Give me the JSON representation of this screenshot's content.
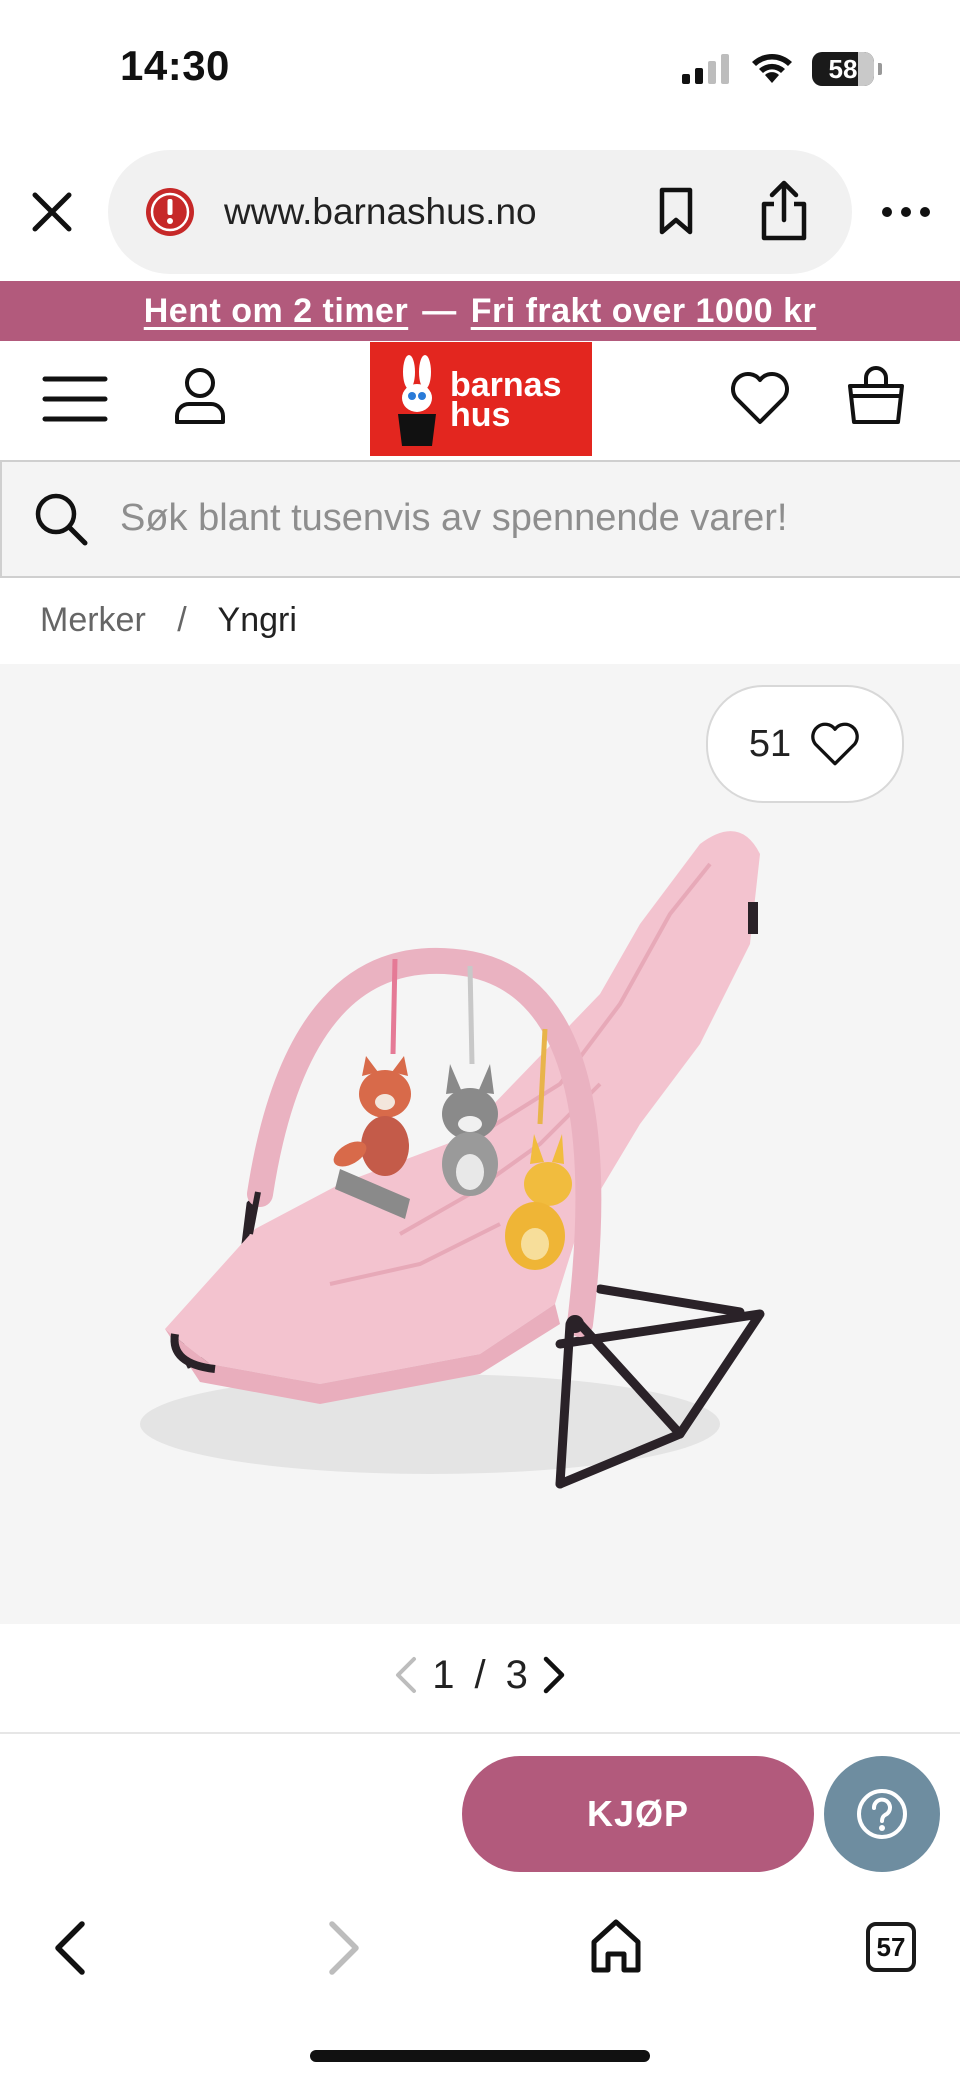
{
  "status_bar": {
    "time": "14:30",
    "battery": "58"
  },
  "browser": {
    "url": "www.barnashus.no",
    "icons": [
      "close-icon",
      "warning-icon",
      "bookmark-icon",
      "share-icon",
      "more-icon"
    ]
  },
  "promo": {
    "left_link": "Hent om 2 timer",
    "separator": "—",
    "right_link": "Fri frakt over 1000 kr"
  },
  "header": {
    "logo_line1": "barnas",
    "logo_line2": "hus",
    "icons": [
      "menu-icon",
      "user-icon",
      "heart-icon",
      "bag-icon"
    ]
  },
  "search": {
    "placeholder": "Søk blant tusenvis av spennende varer!"
  },
  "breadcrumb": {
    "items": [
      "Merker",
      "Yngri"
    ],
    "separator": "/"
  },
  "product": {
    "favorites_count": "51"
  },
  "pager": {
    "current": "1",
    "separator": "/",
    "total": "3"
  },
  "actions": {
    "buy_label": "KJØP"
  },
  "bottom_nav": {
    "tabs_count": "57"
  },
  "colors": {
    "accent": "#b25a7c",
    "logo_red": "#e3261f",
    "help_blue": "#6e8da0"
  }
}
